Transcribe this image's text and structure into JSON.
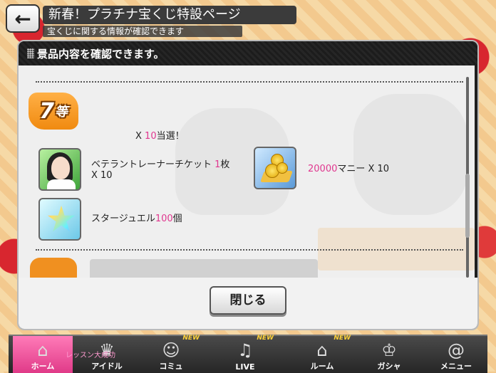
{
  "header": {
    "back_icon": "arrow-left-icon",
    "title": "新春！プラチナ宝くじ特設ページ",
    "subtitle": "宝くじに関する情報が確認できます"
  },
  "modal": {
    "title": "景品内容を確認できます。",
    "rank": {
      "number": "7",
      "suffix": "等"
    },
    "win_prefix": "X ",
    "win_count": "10",
    "win_suffix": "当選！",
    "items": [
      {
        "icon": "trainer-ticket-icon",
        "name": "ベテラントレーナーチケット ",
        "amount": "1",
        "unit": "枚",
        "multiplier": "X 10"
      },
      {
        "icon": "money-icon",
        "amount": "20000",
        "name": "マニー X 10"
      },
      {
        "icon": "star-jewel-icon",
        "name": "スタージュエル",
        "amount": "100",
        "unit": "個"
      }
    ],
    "close_label": "閉じる"
  },
  "nav": {
    "items": [
      {
        "label": "ホーム",
        "icon": "home-icon",
        "glyph": "⌂",
        "new": ""
      },
      {
        "label": "アイドル",
        "icon": "idol-icon",
        "glyph": "♛",
        "new": ""
      },
      {
        "label": "コミュ",
        "icon": "commu-icon",
        "glyph": "☺",
        "new": "NEW"
      },
      {
        "label": "LIVE",
        "icon": "live-icon",
        "glyph": "♫",
        "new": "NEW"
      },
      {
        "label": "ルーム",
        "icon": "room-icon",
        "glyph": "⌂",
        "new": "NEW"
      },
      {
        "label": "ガシャ",
        "icon": "gacha-icon",
        "glyph": "♔",
        "new": ""
      },
      {
        "label": "メニュー",
        "icon": "menu-icon",
        "glyph": "@",
        "new": ""
      }
    ],
    "sub_text": "レッスン大成功"
  },
  "colors": {
    "accent_pink": "#e0378f",
    "rank_orange": "#f08a10",
    "nav_active": "#e03a88"
  }
}
